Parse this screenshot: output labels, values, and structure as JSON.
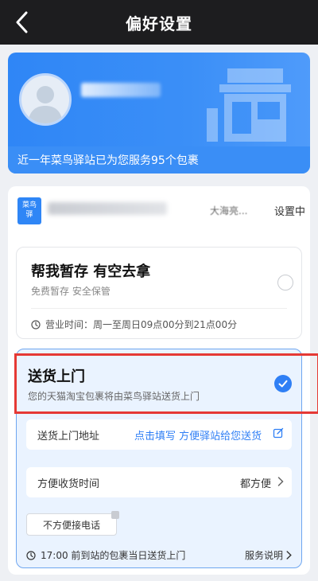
{
  "header": {
    "title": "偏好设置"
  },
  "hero": {
    "service_text": "近一年菜鸟驿站已为您服务95个包裹"
  },
  "station": {
    "logo_text": "菜鸟驿",
    "address_partial": "大海亮...",
    "setting_label": "设置中"
  },
  "option_self_pickup": {
    "title": "帮我暂存 有空去拿",
    "subtitle": "免费暂存 安全保管",
    "hours": "营业时间：周一至周日09点00分到21点00分"
  },
  "option_delivery": {
    "title": "送货上门",
    "subtitle": "您的天猫淘宝包裹将由菜鸟驿站送货上门",
    "address_label": "送货上门地址",
    "address_value": "点击填写 方便驿站给您送货",
    "time_label": "方便收货时间",
    "time_value": "都方便",
    "phone_chip": "不方便接电话",
    "note": "17:00 前到站的包裹当日送货上门",
    "service_link": "服务说明"
  },
  "colors": {
    "accent": "#2f7ff5",
    "hero_blue": "#2f86f6",
    "highlight_red": "#e53935"
  }
}
